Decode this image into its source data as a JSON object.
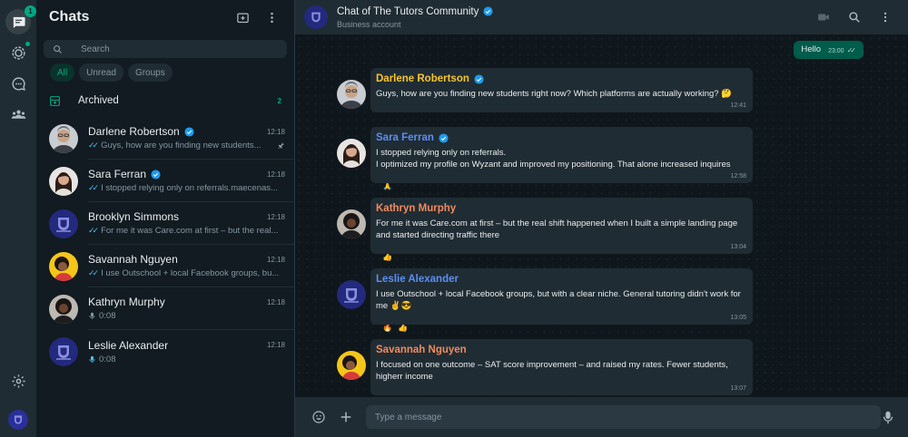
{
  "rail": {
    "chats_badge": "1",
    "icons": [
      "chats-icon",
      "status-icon",
      "channels-icon",
      "communities-icon",
      "settings-icon"
    ]
  },
  "sidebar": {
    "title": "Chats",
    "search_placeholder": "Search",
    "filters": [
      "All",
      "Unread",
      "Groups"
    ],
    "archived_label": "Archived",
    "archived_count": "2",
    "chats": [
      {
        "name": "Darlene Robertson",
        "verified": true,
        "time": "12:18",
        "preview": "Guys, how are you finding new students...",
        "status": "ticks",
        "pinned": true
      },
      {
        "name": "Sara Ferran",
        "verified": true,
        "time": "12:18",
        "preview": "I stopped relying only on referrals.maecenas...",
        "status": "ticks",
        "pinned": false
      },
      {
        "name": "Brooklyn Simmons",
        "verified": false,
        "time": "12:18",
        "preview": "For me it was Care.com at first – but the real...",
        "status": "ticks",
        "pinned": false
      },
      {
        "name": "Savannah Nguyen",
        "verified": false,
        "time": "12:18",
        "preview": "I use Outschool + local Facebook groups, bu...",
        "status": "ticks",
        "pinned": false
      },
      {
        "name": "Kathryn Murphy",
        "verified": false,
        "time": "12:18",
        "preview": "0:08",
        "status": "mic",
        "pinned": false
      },
      {
        "name": "Leslie Alexander",
        "verified": false,
        "time": "12:18",
        "preview": "0:08",
        "status": "mic-blue",
        "pinned": false
      }
    ]
  },
  "conversation": {
    "title": "Chat of The Tutors Community",
    "subtitle": "Business account",
    "outgoing": {
      "text": "Hello",
      "time": "23:00"
    },
    "messages": [
      {
        "sender": "Darlene Robertson",
        "color": "#f7c52c",
        "verified": true,
        "text": "Guys, how are you finding new students right now? Which platforms are actually working? 🤔",
        "time": "12:41",
        "reactions": []
      },
      {
        "sender": "Sara Ferran",
        "color": "#5b8ef5",
        "verified": true,
        "text": "I stopped relying only on referrals.\nI optimized my profile on Wyzant and improved my positioning. That alone increased inquires",
        "time": "12:58",
        "reactions": [
          "🙏"
        ]
      },
      {
        "sender": "Kathryn Murphy",
        "color": "#f08a5d",
        "verified": false,
        "text": "For me it was Care.com at first – but the real shift happened when I built a simple landing page and started directing traffic there",
        "time": "13:04",
        "reactions": [
          "👍"
        ]
      },
      {
        "sender": "Leslie Alexander",
        "color": "#5b8ef5",
        "verified": false,
        "text": "I use Outschool + local Facebook groups, but with a clear niche. General tutoring didn't work for me ✌😎",
        "time": "13:05",
        "reactions": [
          "🔥",
          "👍"
        ]
      },
      {
        "sender": "Savannah Nguyen",
        "color": "#f08a5d",
        "verified": false,
        "text": "I focused on one outcome – SAT score improvement – and raised my rates. Fewer students, higherr income",
        "time": "13:07",
        "reactions": []
      }
    ],
    "composer_placeholder": "Type a message"
  }
}
